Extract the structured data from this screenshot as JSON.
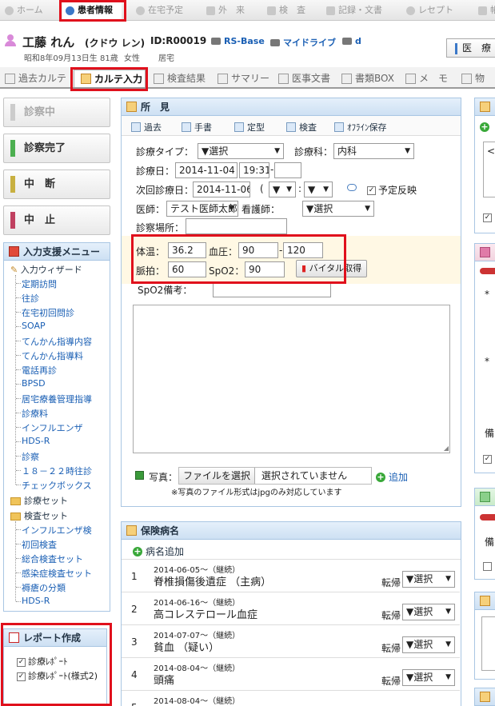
{
  "top_nav": [
    {
      "label": "ホーム",
      "icon": "home-icon"
    },
    {
      "label": "患者情報",
      "icon": "patient-icon",
      "active": true
    },
    {
      "label": "在宅予定",
      "icon": "clock-icon"
    },
    {
      "label": "外　来",
      "icon": "grid-icon"
    },
    {
      "label": "検　査",
      "icon": "grid-icon"
    },
    {
      "label": "記録・文書",
      "icon": "document-icon"
    },
    {
      "label": "レセプト",
      "icon": "cloud-icon"
    },
    {
      "label": "帳",
      "icon": "folder-icon"
    }
  ],
  "patient": {
    "name": "工藤 れん",
    "kana": "(クドウ レン)",
    "id_label": "ID:R00019",
    "birth": "昭和8年09月13日生 81歳",
    "gender": "女性",
    "location": "居宅",
    "links": [
      "RS-Base",
      "マイドライブ",
      "d"
    ],
    "right_button": "医　療"
  },
  "tabs": [
    {
      "label": "過去カルテ"
    },
    {
      "label": "カルテ入力",
      "active": true
    },
    {
      "label": "検査結果"
    },
    {
      "label": "サマリー"
    },
    {
      "label": "医事文書"
    },
    {
      "label": "書類BOX"
    },
    {
      "label": "メ　モ"
    },
    {
      "label": "物"
    }
  ],
  "status_buttons": [
    {
      "label": "診察中",
      "color": "#cccccc"
    },
    {
      "label": "診察完了",
      "color": "#4caf50"
    },
    {
      "label": "中　断",
      "color": "#c8b040"
    },
    {
      "label": "中　止",
      "color": "#c04060"
    }
  ],
  "input_menu": {
    "title": "入力支援メニュー",
    "wizard": "入力ウィザード",
    "wizard_items": [
      "定期訪問",
      "往診",
      "在宅初回問診",
      "SOAP",
      "てんかん指導内容",
      "てんかん指導料",
      "電話再診",
      "BPSD",
      "居宅療養管理指導",
      "診療料",
      "インフルエンザ",
      "HDS-R",
      "診察",
      "１８－２２時往診",
      "チェックボックス"
    ],
    "set1": "診療セット",
    "set2": "検査セット",
    "set2_items": [
      "インフルエンザ検",
      "初回検査",
      "総合検査セット",
      "感染症検査セット",
      "褥瘡の分類",
      "HDS-R"
    ]
  },
  "report_menu": {
    "title": "レポート作成",
    "items": [
      "診療ﾚﾎﾟｰﾄ",
      "診療ﾚﾎﾟｰﾄ(様式2)"
    ]
  },
  "findings": {
    "title": "所　見",
    "toolbar": [
      "過去",
      "手書",
      "定型",
      "検査",
      "ｵﾌﾗｲﾝ保存"
    ],
    "type_label": "診療タイプ：",
    "type_value": "▼選択",
    "dept_label": "診療科：",
    "dept_value": "内科",
    "date_label": "診療日：",
    "date_value": "2014-11-04",
    "time_value": "19:31",
    "time_sep": "-",
    "next_label": "次回診療日：",
    "next_value": "2014-11-06",
    "paren_open": "(",
    "colon": ":",
    "reflect_label": "予定反映",
    "doctor_label": "医師：",
    "doctor_value": "テスト医師太郎",
    "nurse_label": "看護師：",
    "nurse_value": "▼選択",
    "place_label": "診察場所：",
    "temp_label": "体温：",
    "temp_value": "36.2",
    "bp_label": "血圧：",
    "bp_high": "90",
    "bp_sep": "-",
    "bp_low": "120",
    "pulse_label": "脈拍：",
    "pulse_value": "60",
    "spo2_label": "SpO2：",
    "spo2_value": "90",
    "vital_button": "バイタル取得",
    "spo2_note_label": "SpO2備考：",
    "photo_label": "写真：",
    "file_button": "ファイルを選択",
    "file_status": "選択されていません",
    "add_label": "追加",
    "photo_note": "※写真のファイル形式はjpgのみ対応しています"
  },
  "insurance": {
    "title": "保険病名",
    "add_label": "病名追加",
    "outcome_label": "転帰",
    "select_label": "▼選択",
    "rows": [
      {
        "no": "1",
        "date": "2014-06-05～（継続）",
        "name": "脊椎損傷後遺症 （主病）"
      },
      {
        "no": "2",
        "date": "2014-06-16～（継続）",
        "name": "高コレステロール血症"
      },
      {
        "no": "3",
        "date": "2014-07-07～（継続）",
        "name": "貧血 （疑い）"
      },
      {
        "no": "4",
        "date": "2014-08-04～（継続）",
        "name": "頭痛"
      },
      {
        "no": "5",
        "date": "2014-08-04～（継続）",
        "name": ""
      }
    ]
  },
  "right_panels": {
    "frag1": "<",
    "frag2": "*",
    "frag3": "*",
    "frag4": "備",
    "frag5": "備"
  }
}
